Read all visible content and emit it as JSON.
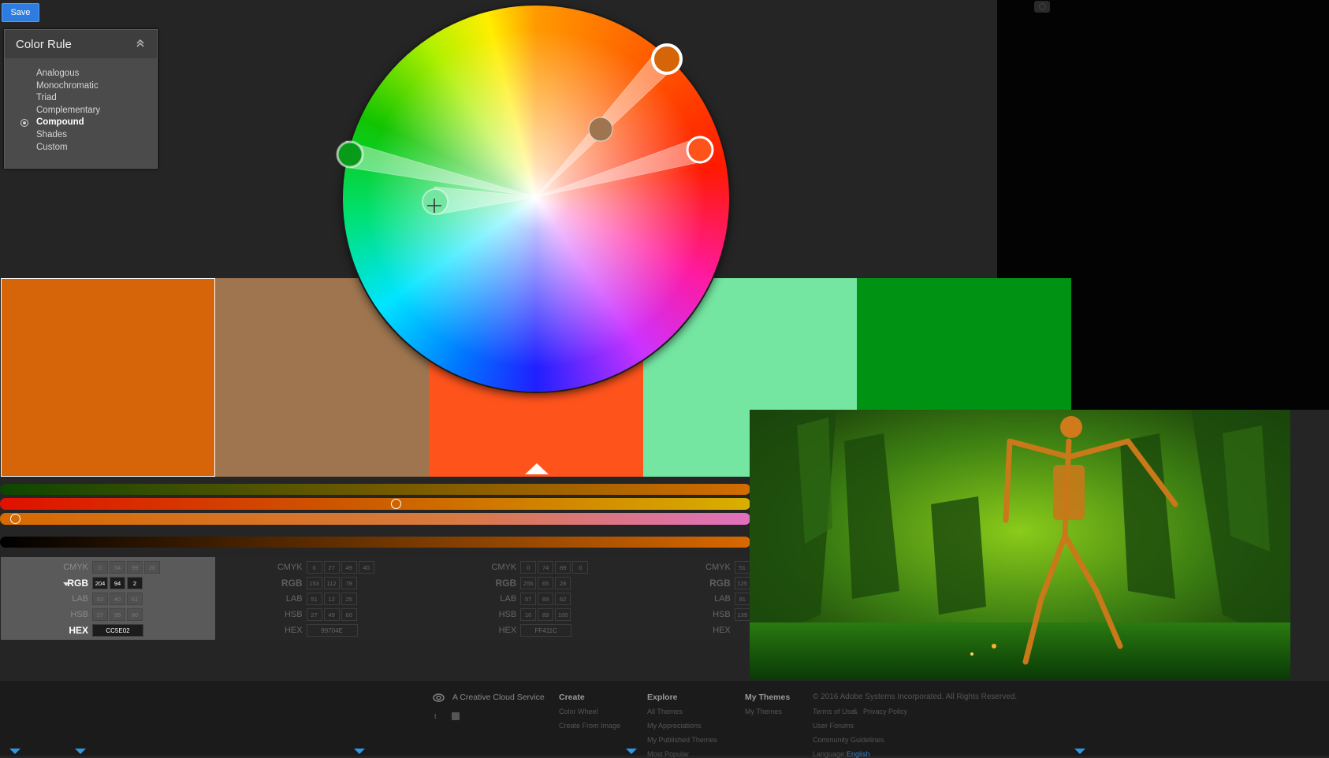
{
  "toolbar": {
    "save_label": "Save"
  },
  "color_rule": {
    "title": "Color Rule",
    "items": [
      "Analogous",
      "Monochromatic",
      "Triad",
      "Complementary",
      "Compound",
      "Shades",
      "Custom"
    ],
    "selected": "Compound"
  },
  "swatches": [
    {
      "color": "#d6650a"
    },
    {
      "color": "#9e754f"
    },
    {
      "color": "#ff531c"
    },
    {
      "color": "#75e6a2"
    },
    {
      "color": "#009313"
    }
  ],
  "labels": {
    "cmyk": "CMYK",
    "rgb": "RGB",
    "lab": "LAB",
    "hsb": "HSB",
    "hex": "HEX"
  },
  "panels": [
    {
      "cmyk": [
        "0",
        "54",
        "99",
        "20"
      ],
      "rgb": [
        "204",
        "94",
        "2"
      ],
      "lab": [
        "53",
        "40",
        "61"
      ],
      "hsb": [
        "27",
        "99",
        "80"
      ],
      "hex": "CC5E02"
    },
    {
      "cmyk": [
        "0",
        "27",
        "49",
        "40"
      ],
      "rgb": [
        "153",
        "112",
        "78"
      ],
      "lab": [
        "51",
        "12",
        "25"
      ],
      "hsb": [
        "27",
        "49",
        "60"
      ],
      "hex": "99704E"
    },
    {
      "cmyk": [
        "0",
        "74",
        "89",
        "0"
      ],
      "rgb": [
        "255",
        "65",
        "28"
      ],
      "lab": [
        "57",
        "69",
        "62"
      ],
      "hsb": [
        "10",
        "89",
        "100"
      ],
      "hex": "FF411C"
    },
    {
      "cmyk": [
        "51"
      ],
      "rgb": [
        "125"
      ],
      "lab": [
        "91"
      ],
      "hsb": [
        "139"
      ],
      "hex": ""
    }
  ],
  "sliders": {
    "red_position": 0.527,
    "hue_position": 0.02
  },
  "footer": {
    "ccs": "A Creative Cloud Service",
    "create": {
      "title": "Create",
      "links": [
        "Color Wheel",
        "Create From Image"
      ]
    },
    "explore": {
      "title": "Explore",
      "links": [
        "All Themes",
        "My Appreciations",
        "My Published Themes",
        "Most Popular"
      ]
    },
    "mythemes": {
      "title": "My Themes",
      "links": [
        "My Themes"
      ]
    },
    "copyright": "© 2016 Adobe Systems Incorporated. All Rights Reserved.",
    "terms": "Terms of Use",
    "amp": "&",
    "privacy": "Privacy Policy",
    "forums": "User Forums",
    "guidelines": "Community Guidelines",
    "language_label": "Language:",
    "language_value": "English"
  },
  "icons": [
    "collapse-chevron-icon",
    "radio-selected-icon",
    "camera-icon",
    "creative-cloud-icon",
    "twitter-icon",
    "facebook-icon",
    "crosshair-icon"
  ]
}
